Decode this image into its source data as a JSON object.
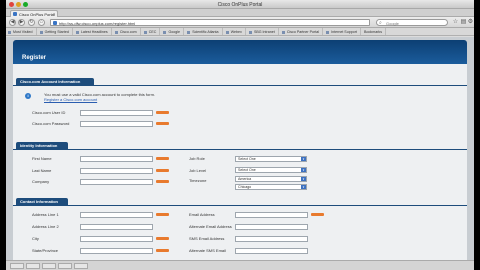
{
  "window": {
    "title": "Cisco OnPlus Portal"
  },
  "tab": {
    "label": "Cisco OnPlus Portal",
    "close_glyph": "x"
  },
  "toolbar": {
    "url": "http://ss-dfw.cisco-onplus.com/register.html",
    "search_placeholder": "Google",
    "back_glyph": "◀",
    "forward_glyph": "▶",
    "refresh_glyph": "↻",
    "home_glyph": "⌂",
    "bookmark_glyph": "☆",
    "page_glyph": "▤",
    "tools_glyph": "⚙"
  },
  "bookmarks": [
    "Most Visited",
    "Getting Started",
    "Latest Headlines",
    "Cisco.com",
    "CEC",
    "Google",
    "Scientific Atlanta",
    "Webex",
    "SBG Intranet",
    "Cisco Partner Portal",
    "Internet Support",
    "Bookmarks"
  ],
  "page": {
    "portal_title": "Register",
    "sections": {
      "account": "Cisco.com Account Information",
      "identity": "Identity Information",
      "contact": "Contact Information"
    },
    "account_info": {
      "notice": "You must use a valid Cisco.com account to complete this form.",
      "link": "Register a Cisco.com account",
      "fields": {
        "user_id": "Cisco.com User ID",
        "password": "Cisco.com Password"
      }
    },
    "identity": {
      "first_name": "First Name",
      "last_name": "Last Name",
      "company": "Company",
      "job_role": "Job Role",
      "job_level": "Job Level",
      "timezone": "Timezone",
      "job_role_value": "Select One",
      "job_level_value": "Select One",
      "timezone_region": "America",
      "timezone_city": "Chicago"
    },
    "contact": {
      "address1": "Address Line 1",
      "address2": "Address Line 2",
      "city": "City",
      "state": "State/Province",
      "email": "Email Address",
      "alt_email": "Alternate Email Address",
      "sms": "SMS Email Address",
      "alt_sms": "Alternate SMS Email"
    }
  },
  "statusbar": [
    "",
    "",
    "",
    "",
    ""
  ],
  "colors": {
    "header": "#1b5c9c",
    "section": "#1d4c7c",
    "required": "#e87a2e",
    "select_arrow": "#3d72c2"
  }
}
